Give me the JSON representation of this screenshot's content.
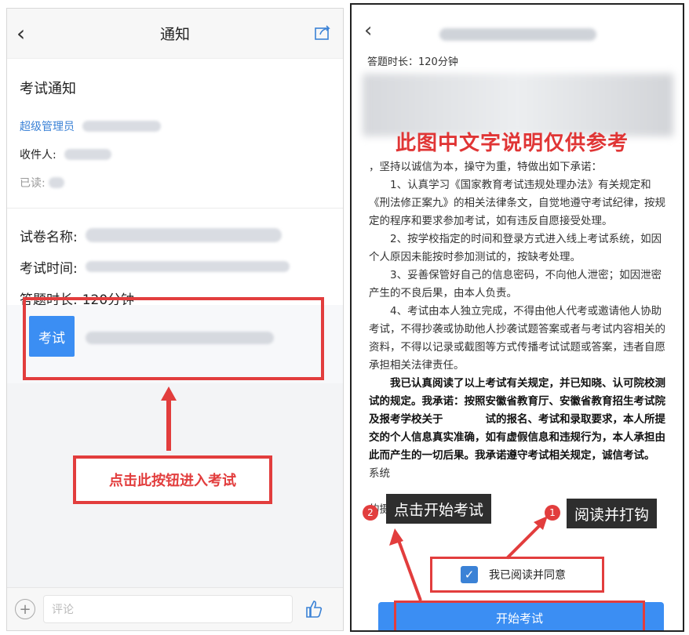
{
  "left": {
    "nav_title": "通知",
    "subject": "考试通知",
    "sender_label": "超级管理员",
    "recipients_label": "收件人:",
    "read_label": "已读:",
    "paper_label": "试卷名称:",
    "time_label": "考试时间:",
    "duration_label": "答题时长:",
    "duration_value": "120分钟",
    "exam_button": "考试",
    "annotation": "点击此按钮进入考试",
    "comment_placeholder": "评论"
  },
  "right": {
    "duration_line": "答题时长：120分钟",
    "watermark": "此图中文字说明仅供参考",
    "body": [
      "，坚持以诚信为本，操守为重，特做出如下承诺：",
      "　　1、认真学习《国家教育考试违规处理办法》有关规定和《刑法修正案九》的相关法律条文，自觉地遵守考试纪律，按规定的程序和要求参加考试，如有违反自愿接受处理。",
      "　　2、按学校指定的时间和登录方式进入线上考试系统，如因个人原因未能按时参加测试的，按缺考处理。",
      "　　3、妥善保管好自己的信息密码，不向他人泄密；如因泄密产生的不良后果，由本人负责。",
      "　　4、考试由本人独立完成，不得由他人代考或邀请他人协助考试，不得抄袭或协助他人抄袭试题答案或者与考试内容相关的资料，不得以记录或截图等方式传播考试试题或答案，违者自愿承担相关法律责任。"
    ],
    "pledge": "　　我已认真阅读了以上考试有关规定，并已知晓、认可院校测试的规定。我承诺：按照安徽省教育厅、安徽省教育招生考试院及报考学校关于　　　　试的报名、考试和录取要求，本人所提交的个人信息真实准确，如有虚假信息和违规行为，本人承担由此而产生的一切后果。我承诺遵守考试相关规定，诚信考试。",
    "tail1": "系统",
    "tail2": "的摄像头，请确认同意。",
    "label_start": "点击开始考试",
    "label_read": "阅读并打钩",
    "dot1": "1",
    "dot2": "2",
    "agree_text": "我已阅读并同意",
    "start_button": "开始考试"
  }
}
